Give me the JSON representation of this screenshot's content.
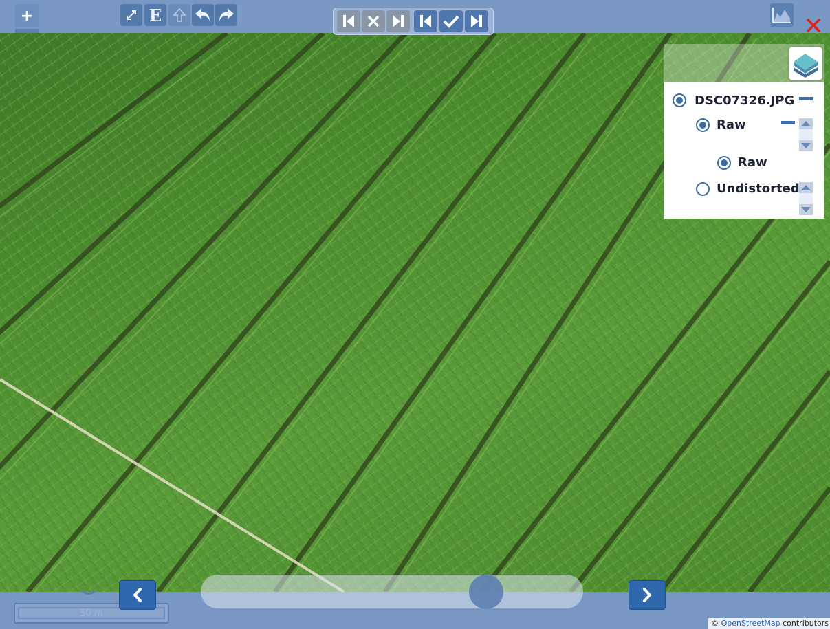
{
  "toolbar": {
    "zoom_in_label": "+",
    "edit_buttons": [
      {
        "icon": "expand-arrows-icon",
        "glyph": "⤢"
      },
      {
        "icon": "letter-e-icon",
        "glyph": "E"
      },
      {
        "icon": "upload-arrow-icon",
        "glyph": "⇧"
      },
      {
        "icon": "undo-icon",
        "glyph": "↶"
      },
      {
        "icon": "redo-icon",
        "glyph": "↷"
      }
    ],
    "nav_buttons": [
      {
        "icon": "skip-first-icon"
      },
      {
        "icon": "reject-x-icon"
      },
      {
        "icon": "skip-last-icon"
      },
      {
        "icon": "skip-first-icon"
      },
      {
        "icon": "accept-check-icon"
      },
      {
        "icon": "skip-last-icon"
      }
    ],
    "profile_icon": "elevation-profile-icon",
    "close_icon": "close-x-icon"
  },
  "layers": {
    "switcher_icon": "layers-icon",
    "image_name": "DSC07326.JPG",
    "group_label": "Raw",
    "options": [
      {
        "label": "Raw",
        "selected": true
      },
      {
        "label": "Undistorted",
        "selected": false
      }
    ]
  },
  "bottom": {
    "scale_label": "50 m",
    "prev_icon": "chevron-left-icon",
    "next_icon": "chevron-right-icon",
    "slider_value": 0.78,
    "attribution": {
      "prefix": "©",
      "link": "OpenStreetMap",
      "suffix": " contributors"
    }
  },
  "colors": {
    "bar": "#7a98c4",
    "button": "#4f77ad",
    "close_red": "#d9261c",
    "radio": "#3d6da6"
  }
}
